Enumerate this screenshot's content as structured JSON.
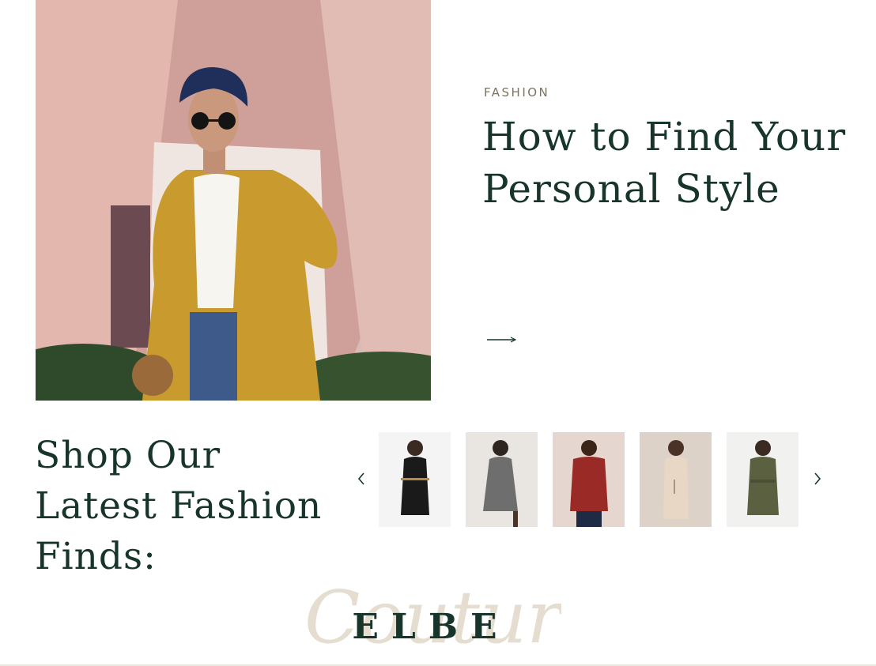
{
  "post": {
    "category": "FASHION",
    "title": "How to Find Your Personal Style",
    "image_alt": "Woman in mustard trench coat, navy turban and sunglasses"
  },
  "shop": {
    "heading": "Shop Our Latest Fashion Finds:",
    "products": [
      {
        "name": "black dress",
        "color": "#1a1a1a",
        "bg": "#f4f4f4"
      },
      {
        "name": "grey knit dress",
        "color": "#6e6e6e",
        "bg": "#e9e6e1"
      },
      {
        "name": "red sweater",
        "color": "#9a2a26",
        "bg": "#e5d6cf"
      },
      {
        "name": "beige dress",
        "color": "#e9d7c5",
        "bg": "#ddd2c8"
      },
      {
        "name": "olive dress",
        "color": "#5b6140",
        "bg": "#f1f1ef"
      }
    ]
  },
  "brand": {
    "name": "ELBE",
    "watermark": "Couture"
  },
  "colors": {
    "heading": "#17352b",
    "category": "#7a7460",
    "watermark": "#e4ddd0"
  }
}
